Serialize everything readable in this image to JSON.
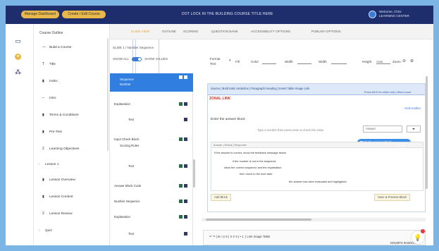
{
  "topbar": {
    "pills": [
      "Manage Dashboard",
      "Create / Edit Course",
      "Help Center",
      "Logout"
    ],
    "title": "DOT LOCK IN THE BUILDING COURSE TITLE HERE",
    "user": {
      "line1": "Welcome, Chris",
      "line2": "LEARNING CENTER"
    }
  },
  "rail": {
    "icons": [
      "window-icon",
      "lightbulb-icon",
      "cubes-icon"
    ]
  },
  "outline": {
    "heading": "Course Outline",
    "items": [
      {
        "icon": "arrow-icon",
        "label": "Build a Course"
      },
      {
        "icon": "t-icon",
        "label": "Title"
      },
      {
        "icon": "bars-icon",
        "label": "Index"
      },
      {
        "icon": "dash-icon",
        "label": "Intro"
      },
      {
        "icon": "bars-icon",
        "label": "Terms & Conditions"
      },
      {
        "icon": "bars-icon",
        "label": "Pre-Test"
      },
      {
        "icon": "check-icon",
        "label": "Learning Objectives"
      },
      {
        "icon": "circle-icon",
        "label": "Lesson 1"
      },
      {
        "icon": "bars-icon",
        "label": "Lesson Overview"
      },
      {
        "icon": "bars-icon",
        "label": "Lesson Content"
      },
      {
        "icon": "check-icon",
        "label": "Lesson Review"
      },
      {
        "icon": "circle-icon",
        "label": "Quiz"
      }
    ]
  },
  "pagebar": {
    "items": [
      "SLIDE VIEW",
      "OUTLINE",
      "SCORING",
      "QUESTION BANK",
      "ACCESSIBILITY OPTIONS",
      "PUBLISH OPTIONS"
    ]
  },
  "middle": {
    "breadcrumb": "SLIDE 1 / Number Sequence",
    "toggle_left": "SHOW ALL",
    "toggle_right": "SHOW VALUES",
    "nodes": [
      {
        "label": "Sequence",
        "sub": "Number",
        "selected": true
      },
      {
        "label": "Explanation",
        "sub": "",
        "selected": false
      },
      {
        "label": "Text",
        "sub": "",
        "selected": false
      },
      {
        "label": "Input Check Block",
        "sub": "Scoring Rules",
        "selected": false
      },
      {
        "label": "Text",
        "sub": "",
        "selected": false
      },
      {
        "label": "Answer Block Code",
        "sub": "",
        "selected": false
      },
      {
        "label": "Number Sequence",
        "sub": "",
        "selected": false
      },
      {
        "label": "Explanation",
        "sub": "",
        "selected": false
      },
      {
        "label": "Text",
        "sub": "",
        "selected": false
      }
    ]
  },
  "controls": {
    "format_label": "Format",
    "format_value": "Text",
    "fill_label": "Fill",
    "color_label": "Color",
    "width_label": "Width",
    "height_label": "Height",
    "height_value": "Auto",
    "zoom_label": "Zoom"
  },
  "editor": {
    "toolbar": "Source  |  Bold  Italic  Underline  |  Paragraph  Heading  |  Insert  Table  Image  Link",
    "note": "Press Alt+0 for editor help  |  Word count",
    "brand": "ZONAL LINK",
    "link": "Hide toolbar",
    "heading": "Enter the answer block",
    "sub": "Type a number then press enter to check the value",
    "input_placeholder": "Answer",
    "tooltip": "Edit the answer block",
    "code_head": "Answer | Result | Response",
    "code_lines": [
      "If the answer is correct, show the feedback message below",
      "if the number is not in the sequence",
      "show the correct sequence and the explanation",
      "then move to the next slide",
      "the answer has been evaluated and highlighted"
    ],
    "btn_left": "Add Block",
    "btn_right": "Save & Preview Block"
  },
  "bottom_editor": {
    "tools": "↶  ↷  |  B  I  U  S  |  ≡  ≡  ≡  |  •  1.  |  Link  Image  Table",
    "label": "DOUBTS IN BOOKS"
  }
}
